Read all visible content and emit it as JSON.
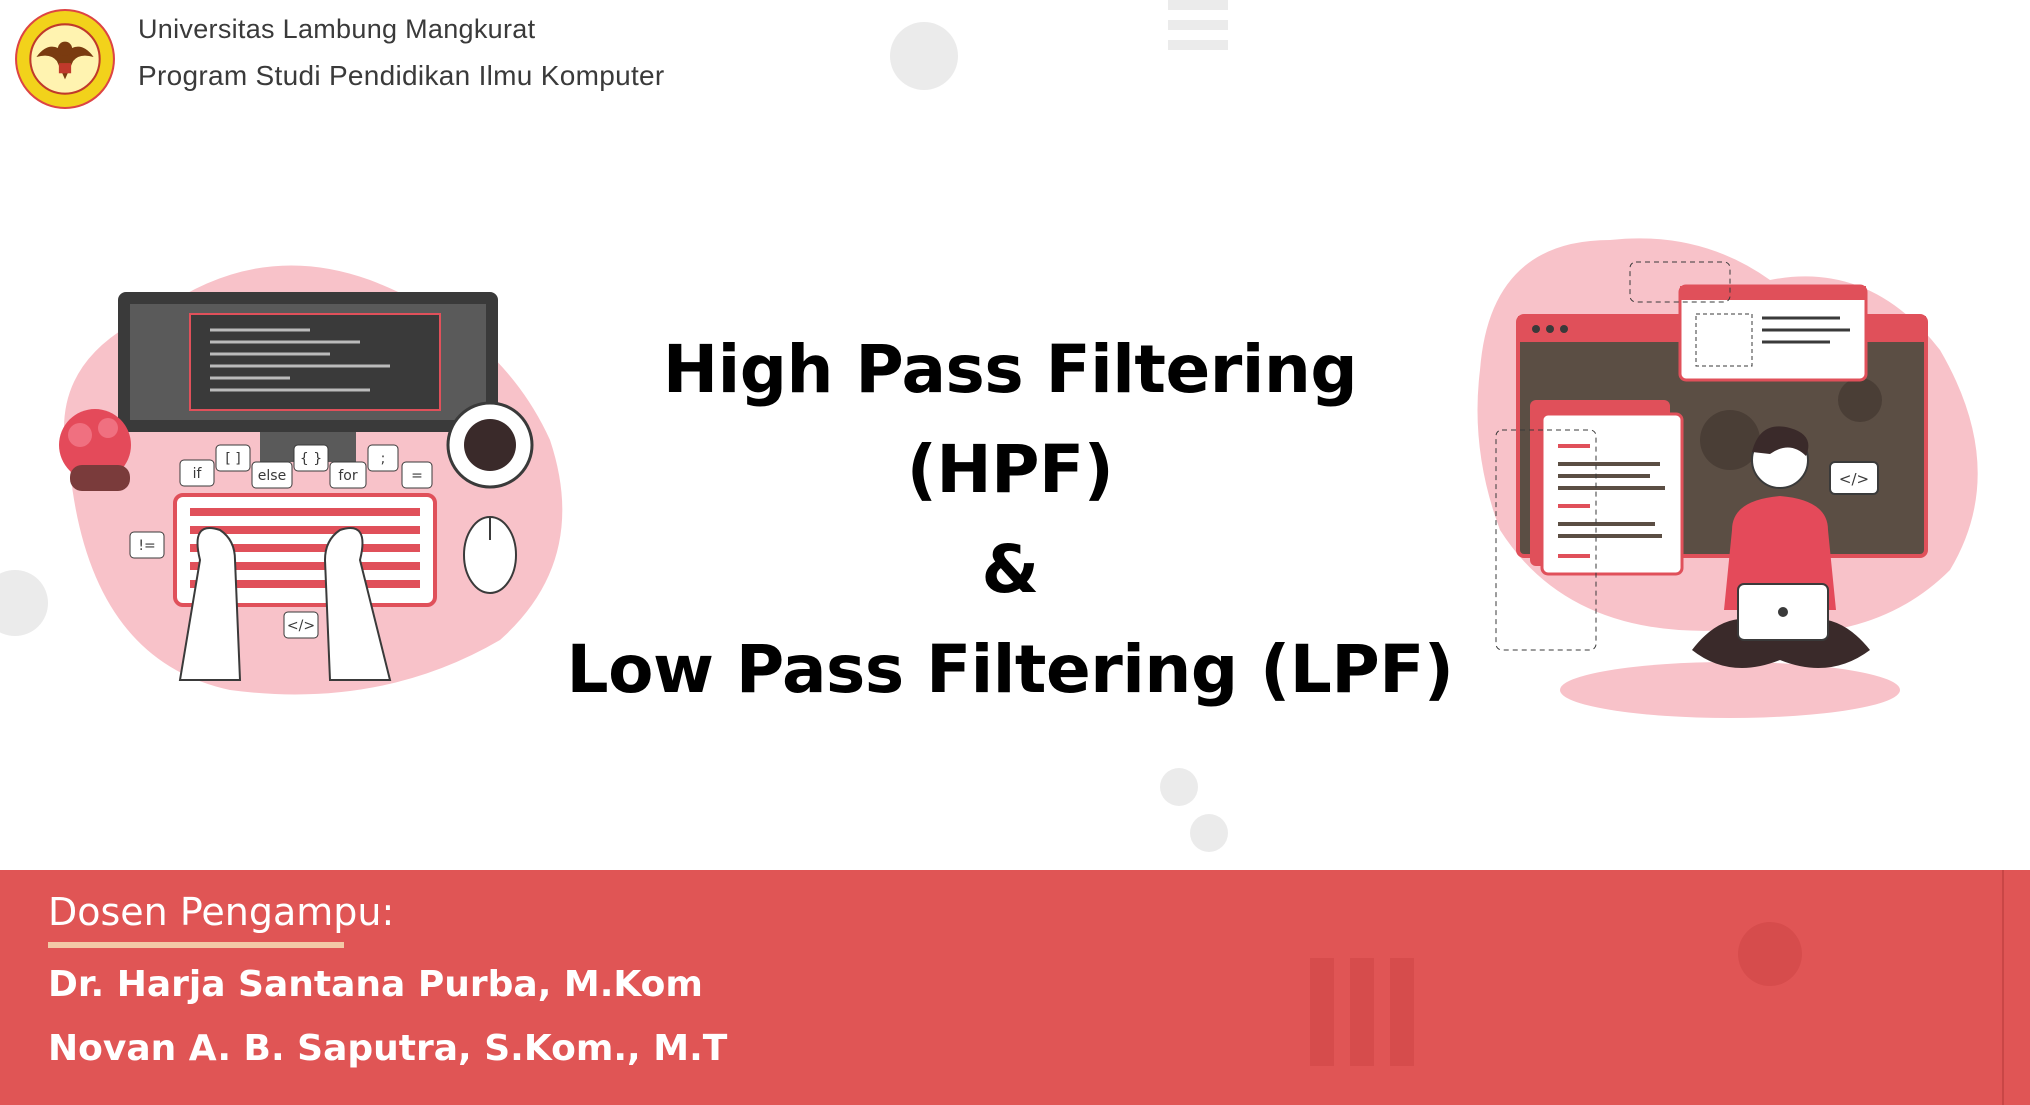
{
  "header": {
    "university": "Universitas Lambung Mangkurat",
    "program": "Program Studi Pendidikan Ilmu Komputer",
    "logo_text": "UNIVERSITAS LAMBUNG MANGKURAT"
  },
  "title": {
    "line1": "High Pass Filtering (HPF)",
    "line2": "&",
    "line3": "Low Pass Filtering (LPF)"
  },
  "illustration_left": {
    "keywords": [
      "if",
      "[ ]",
      "else",
      "{ }",
      "for",
      ";",
      "=",
      "!=",
      "</>"
    ]
  },
  "illustration_right": {
    "code_tag": "</>"
  },
  "footer": {
    "label": "Dosen Pengampu:",
    "lecturers": [
      "Dr. Harja Santana Purba, M.Kom",
      "Novan A. B. Saputra, S.Kom., M.T"
    ]
  },
  "colors": {
    "accent": "#e05555",
    "pink": "#f8c2c9",
    "dark": "#2f2f2f",
    "underline": "#f3c9a6"
  }
}
